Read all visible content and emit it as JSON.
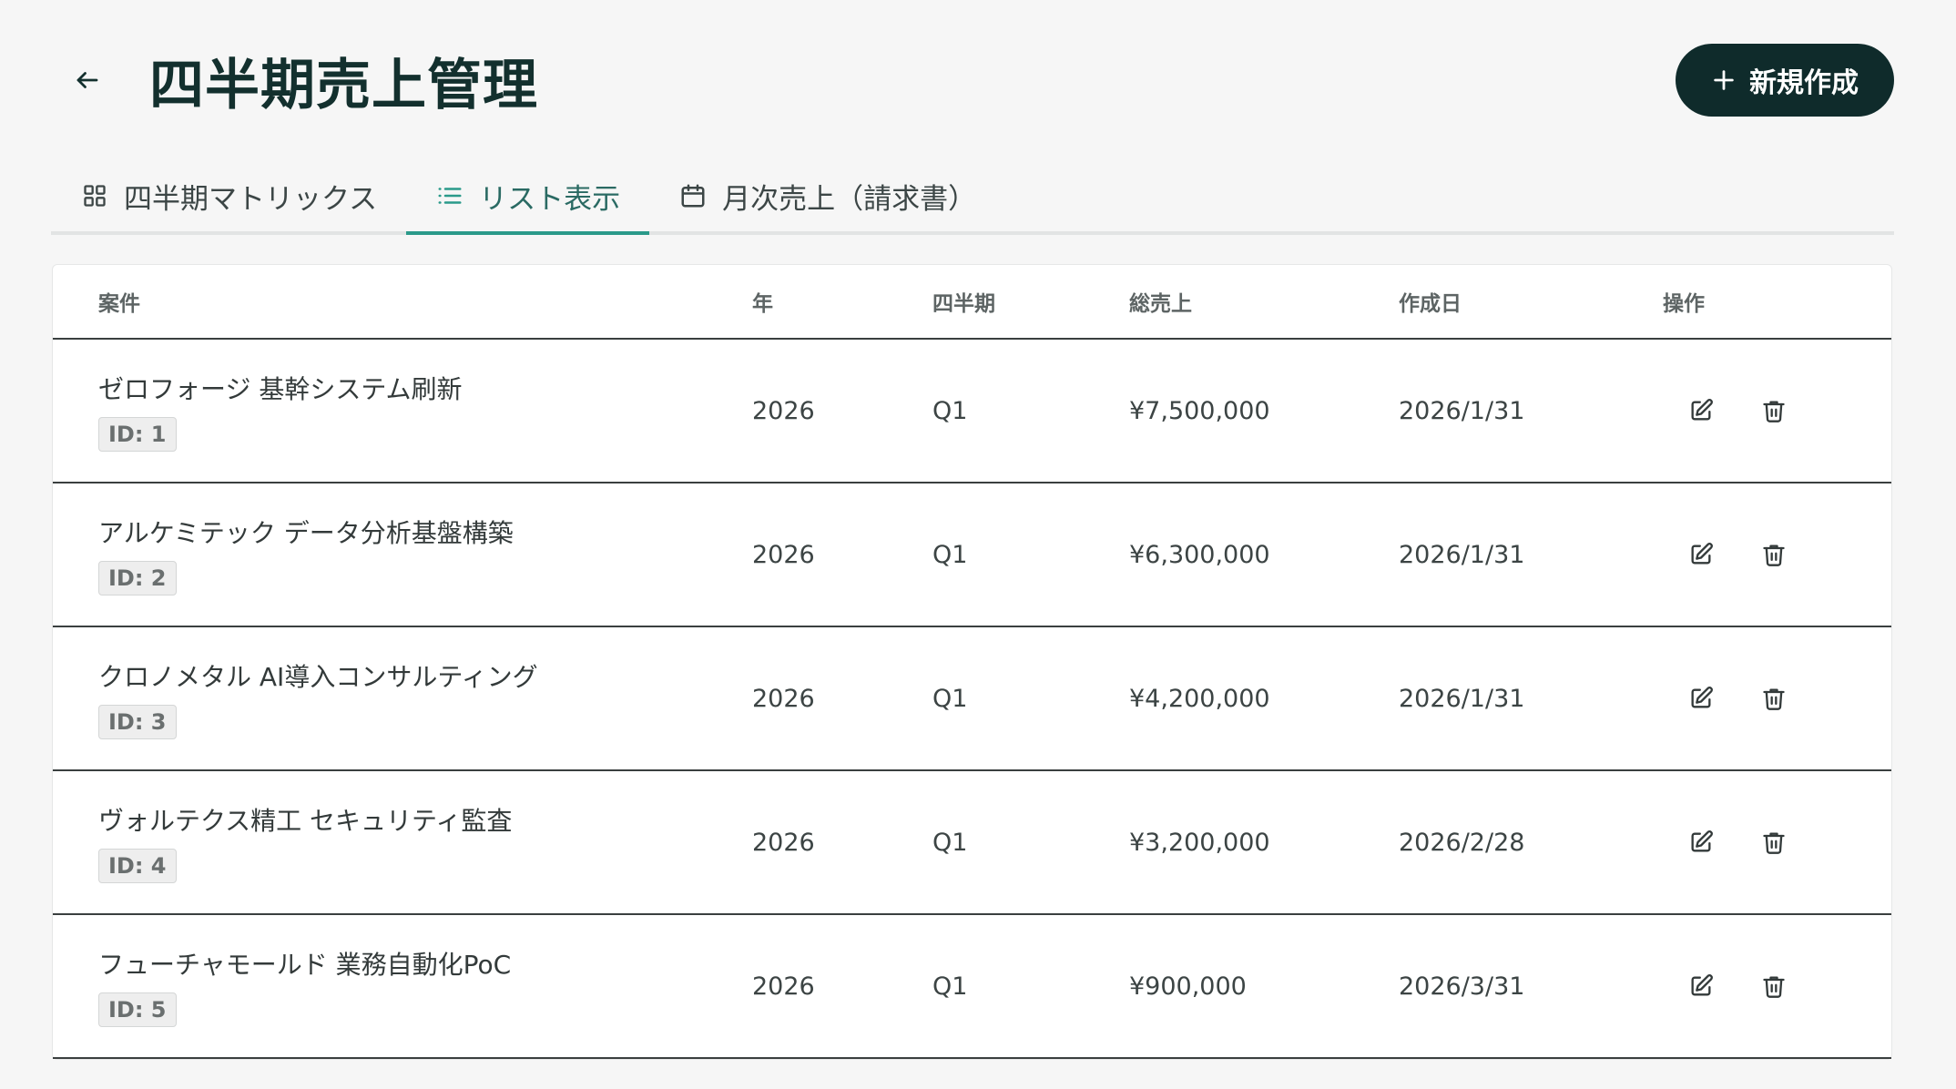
{
  "header": {
    "title": "四半期売上管理",
    "new_button_label": "新規作成"
  },
  "tabs": [
    {
      "label": "四半期マトリックス",
      "icon": "grid-icon",
      "active": false
    },
    {
      "label": "リスト表示",
      "icon": "list-icon",
      "active": true
    },
    {
      "label": "月次売上（請求書）",
      "icon": "calendar-icon",
      "active": false
    }
  ],
  "table": {
    "columns": {
      "name": "案件",
      "year": "年",
      "quarter": "四半期",
      "total": "総売上",
      "created": "作成日",
      "actions": "操作"
    },
    "rows": [
      {
        "name": "ゼロフォージ 基幹システム刷新",
        "id": "ID: 1",
        "year": "2026",
        "quarter": "Q1",
        "total": "¥7,500,000",
        "created": "2026/1/31"
      },
      {
        "name": "アルケミテック データ分析基盤構築",
        "id": "ID: 2",
        "year": "2026",
        "quarter": "Q1",
        "total": "¥6,300,000",
        "created": "2026/1/31"
      },
      {
        "name": "クロノメタル AI導入コンサルティング",
        "id": "ID: 3",
        "year": "2026",
        "quarter": "Q1",
        "total": "¥4,200,000",
        "created": "2026/1/31"
      },
      {
        "name": "ヴォルテクス精工 セキュリティ監査",
        "id": "ID: 4",
        "year": "2026",
        "quarter": "Q1",
        "total": "¥3,200,000",
        "created": "2026/2/28"
      },
      {
        "name": "フューチャモールド 業務自動化PoC",
        "id": "ID: 5",
        "year": "2026",
        "quarter": "Q1",
        "total": "¥900,000",
        "created": "2026/3/31"
      }
    ]
  },
  "colors": {
    "primary_dark": "#0f2b2b",
    "accent": "#2a9a8a",
    "background": "#f6f6f6"
  }
}
